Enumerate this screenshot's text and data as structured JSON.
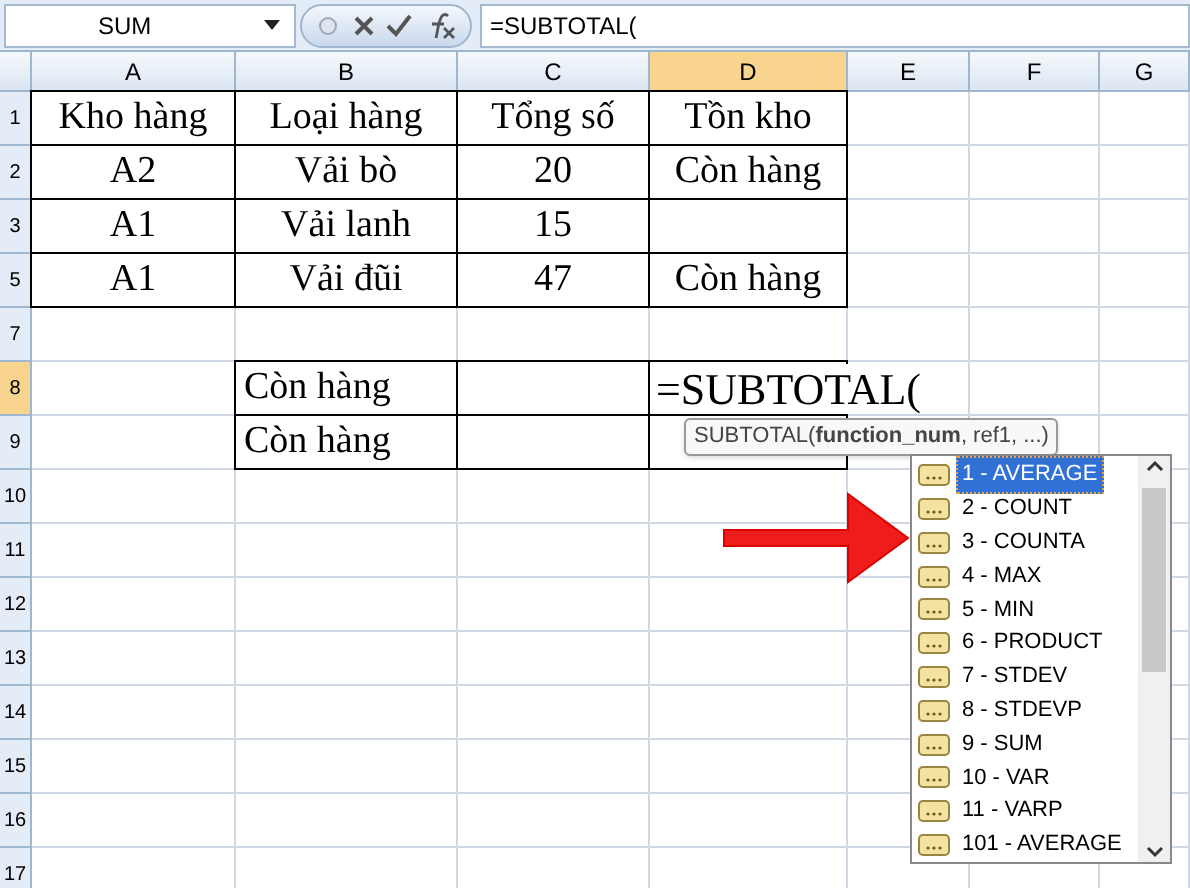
{
  "formula_bar": {
    "name_box": "SUM",
    "formula": "=SUBTOTAL("
  },
  "columns": [
    {
      "label": "A",
      "selected": false
    },
    {
      "label": "B",
      "selected": false
    },
    {
      "label": "C",
      "selected": false
    },
    {
      "label": "D",
      "selected": true
    },
    {
      "label": "E",
      "selected": false
    },
    {
      "label": "F",
      "selected": false
    },
    {
      "label": "G",
      "selected": false
    }
  ],
  "rows": [
    {
      "label": "1",
      "selected": false,
      "cells": [
        {
          "kind": "table",
          "text": "Kho hàng"
        },
        {
          "kind": "table",
          "text": "Loại hàng"
        },
        {
          "kind": "table",
          "text": "Tổng số"
        },
        {
          "kind": "table",
          "text": "Tồn kho"
        }
      ]
    },
    {
      "label": "2",
      "selected": false,
      "cells": [
        {
          "kind": "table",
          "text": "A2"
        },
        {
          "kind": "table",
          "text": "Vải bò"
        },
        {
          "kind": "table",
          "text": "20"
        },
        {
          "kind": "table",
          "text": "Còn hàng"
        }
      ]
    },
    {
      "label": "3",
      "selected": false,
      "cells": [
        {
          "kind": "table",
          "text": "A1"
        },
        {
          "kind": "table",
          "text": "Vải lanh"
        },
        {
          "kind": "table",
          "text": "15"
        },
        {
          "kind": "table"
        }
      ]
    },
    {
      "label": "5",
      "selected": false,
      "cells": [
        {
          "kind": "table",
          "text": "A1"
        },
        {
          "kind": "table",
          "text": "Vải đũi"
        },
        {
          "kind": "table",
          "text": "47"
        },
        {
          "kind": "table",
          "text": "Còn hàng"
        }
      ]
    },
    {
      "label": "7",
      "selected": false,
      "cells": []
    },
    {
      "label": "8",
      "selected": true,
      "cells": [
        {
          "kind": "plain"
        },
        {
          "kind": "label",
          "text": "Còn hàng"
        },
        {
          "kind": "label"
        },
        {
          "kind": "editing",
          "text": "=SUBTOTAL("
        }
      ]
    },
    {
      "label": "9",
      "selected": false,
      "cells": [
        {
          "kind": "plain"
        },
        {
          "kind": "label",
          "text": "Còn hàng"
        },
        {
          "kind": "label"
        },
        {
          "kind": "label"
        }
      ]
    },
    {
      "label": "10",
      "selected": false,
      "cells": []
    },
    {
      "label": "11",
      "selected": false,
      "cells": []
    },
    {
      "label": "12",
      "selected": false,
      "cells": []
    },
    {
      "label": "13",
      "selected": false,
      "cells": []
    },
    {
      "label": "14",
      "selected": false,
      "cells": []
    },
    {
      "label": "15",
      "selected": false,
      "cells": []
    },
    {
      "label": "16",
      "selected": false,
      "cells": []
    },
    {
      "label": "17",
      "selected": false,
      "cells": []
    }
  ],
  "tooltip": {
    "prefix": "SUBTOTAL(",
    "current_arg": "function_num",
    "rest": ", ref1, ...)"
  },
  "autocomplete": [
    {
      "label": "1 - AVERAGE",
      "selected": true
    },
    {
      "label": "2 - COUNT",
      "selected": false
    },
    {
      "label": "3 - COUNTA",
      "selected": false
    },
    {
      "label": "4 - MAX",
      "selected": false
    },
    {
      "label": "5 - MIN",
      "selected": false
    },
    {
      "label": "6 - PRODUCT",
      "selected": false
    },
    {
      "label": "7 - STDEV",
      "selected": false
    },
    {
      "label": "8 - STDEVP",
      "selected": false
    },
    {
      "label": "9 - SUM",
      "selected": false
    },
    {
      "label": "10 - VAR",
      "selected": false
    },
    {
      "label": "11 - VARP",
      "selected": false
    },
    {
      "label": "101 - AVERAGE",
      "selected": false
    }
  ]
}
